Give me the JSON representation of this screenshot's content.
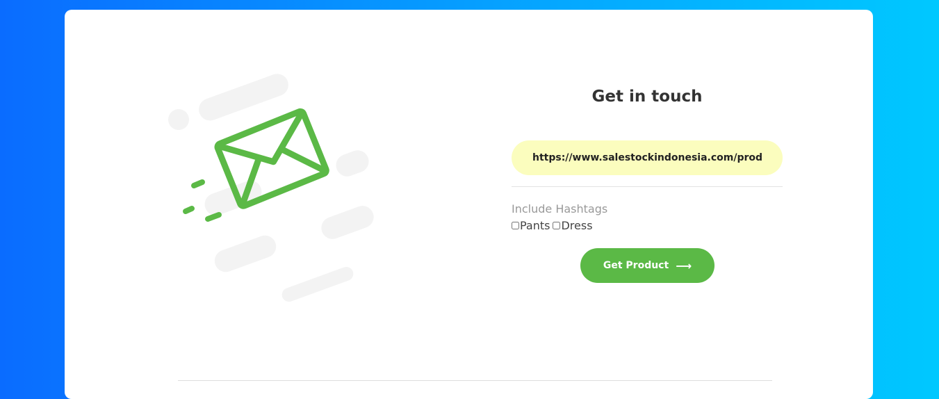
{
  "contact": {
    "title": "Get in touch",
    "url_value": "https://www.salestockindonesia.com/products/baju",
    "url_placeholder": "",
    "hashtags_label": "Include Hashtags",
    "options": [
      {
        "label": "Pants",
        "checked": false
      },
      {
        "label": "Dress",
        "checked": false
      }
    ],
    "submit_label": "Get Product",
    "submit_icon": "arrow-right-icon"
  },
  "colors": {
    "accent": "#5bb946",
    "input_bg": "#fbfdbe",
    "background_start": "#0a6cff",
    "background_end": "#00c8ff"
  },
  "illustration": {
    "icon": "envelope-icon"
  }
}
